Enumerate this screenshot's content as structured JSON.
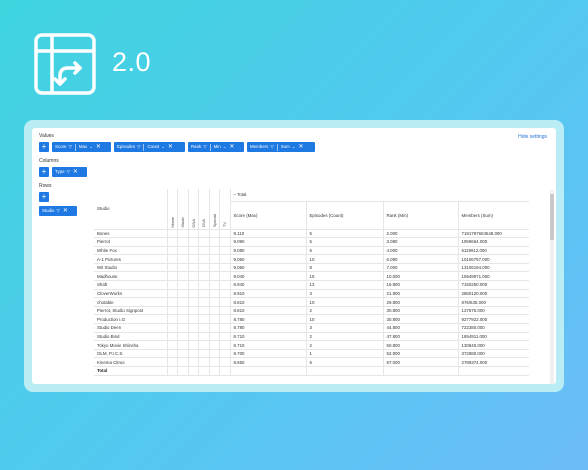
{
  "version": "2.0",
  "hide_settings": "Hide settings",
  "sections": {
    "values": "Values",
    "columns": "Columns",
    "rows": "Rows"
  },
  "add_label": "+",
  "value_chips": [
    {
      "field": "Score",
      "agg": "Max"
    },
    {
      "field": "Episodes",
      "agg": "Count"
    },
    {
      "field": "Rank",
      "agg": "Min"
    },
    {
      "field": "Members",
      "agg": "Sum"
    }
  ],
  "column_chip": "Type",
  "row_chip": "Studio",
  "icons": {
    "filter": "filter-icon",
    "chevron": "chevron-down-icon",
    "close": "close-icon",
    "logo": "pivot-table-icon"
  },
  "table": {
    "studio_header": "Studio",
    "type_columns": [
      "Movie",
      "Music",
      "ONA",
      "OVA",
      "Special",
      "TV"
    ],
    "total_header": "Total",
    "total_toggle": "–",
    "measure_headers": [
      "Score (Max)",
      "Episodes (Count)",
      "Rank (Min)",
      "Members (Sum)"
    ],
    "rows": [
      {
        "studio": "Bones",
        "v": [
          "9.110",
          "5",
          "2.000",
          "7191797604548.000"
        ]
      },
      {
        "studio": "Pierrot",
        "v": [
          "9.090",
          "5",
          "3.080",
          "1959664.000"
        ]
      },
      {
        "studio": "White Fox",
        "v": [
          "9.080",
          "6",
          "4.000",
          "6119912.000"
        ]
      },
      {
        "studio": "A-1 Pictures",
        "v": [
          "9.060",
          "10",
          "6.090",
          "10106757.000"
        ]
      },
      {
        "studio": "Wit Studio",
        "v": [
          "9.060",
          "8",
          "7.000",
          "13106194.000"
        ]
      },
      {
        "studio": "Madhouse",
        "v": [
          "9.040",
          "15",
          "10.000",
          "15949971.000"
        ]
      },
      {
        "studio": "Shaft",
        "v": [
          "8.940",
          "13",
          "16.800",
          "7150250.000"
        ]
      },
      {
        "studio": "CloverWorks",
        "v": [
          "8.910",
          "3",
          "21.800",
          "2850120.000"
        ]
      },
      {
        "studio": "chotable",
        "v": [
          "8.810",
          "10",
          "29.800",
          "876/635.000"
        ]
      },
      {
        "studio": "Pierrot, Studio Signpost",
        "v": [
          "8.810",
          "2",
          "30.800",
          "137575.000"
        ]
      },
      {
        "studio": "Production I.G",
        "v": [
          "8.780",
          "10",
          "30.800",
          "9277922.000"
        ]
      },
      {
        "studio": "Studio Deen",
        "v": [
          "8.780",
          "3",
          "44.800",
          "722380.000"
        ]
      },
      {
        "studio": "Studio Bind",
        "v": [
          "8.710",
          "2",
          "47.800",
          "1854911.000"
        ]
      },
      {
        "studio": "Tokyo Movie Shinsha",
        "v": [
          "8.710",
          "2",
          "50.800",
          "130840.000"
        ]
      },
      {
        "studio": "OLM, P.I.C.S.",
        "v": [
          "8.700",
          "1",
          "52.900",
          "372980.000"
        ]
      },
      {
        "studio": "Kinema Citrus",
        "v": [
          "8.660",
          "6",
          "57.000",
          "2789374.000"
        ]
      },
      {
        "studio": "Total",
        "v": [
          "",
          "",
          "",
          ""
        ]
      }
    ]
  }
}
